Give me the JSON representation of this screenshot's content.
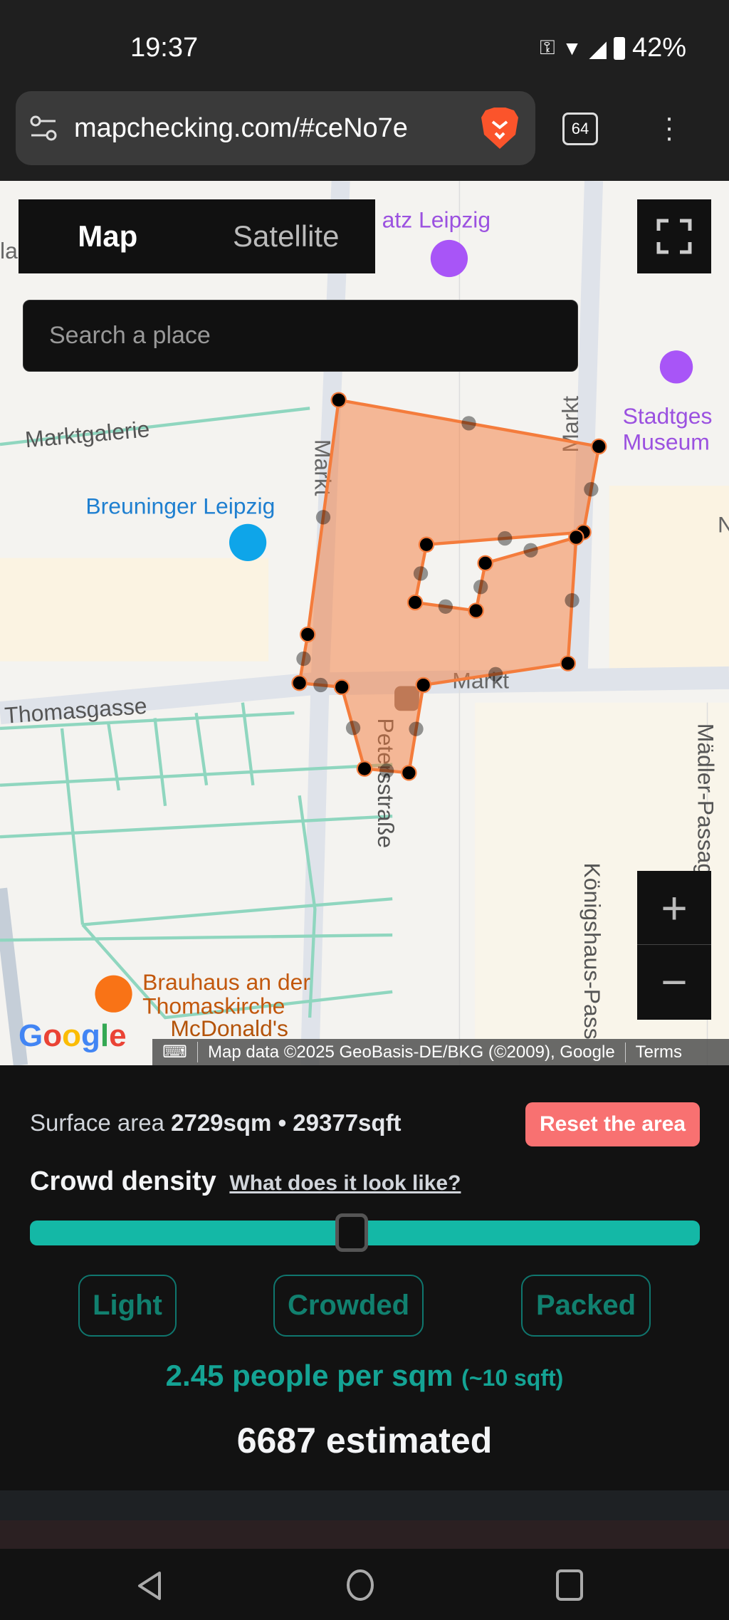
{
  "status_bar": {
    "time": "19:37",
    "battery": "42%",
    "icons": [
      "vpn-key-icon",
      "wifi-icon",
      "signal-icon",
      "battery-icon"
    ]
  },
  "browser": {
    "url": "mapchecking.com/#ceNo7e",
    "tab_count": "64",
    "icons": [
      "site-settings-icon",
      "brave-lion-icon",
      "menu-dots-icon"
    ]
  },
  "map": {
    "toggle": {
      "map": "Map",
      "satellite": "Satellite",
      "selected": "Map"
    },
    "search_placeholder": "Search a place",
    "zoom_in": "+",
    "zoom_out": "−",
    "labels": {
      "platz": "atz Leipzig",
      "marktgalerie": "Marktgalerie",
      "breuninger": "Breuninger Leipzig",
      "museum1": "Stadtges",
      "museum2": "Museum",
      "markt1": "Markt",
      "markt2": "Markt",
      "markt3": "Markt",
      "thomasgasse": "Thomasgasse",
      "petersstrasse": "Petersstraße",
      "maedler": "Mädler-Passage",
      "koenigshaus": "Königshaus-Pass",
      "brauhaus1": "Brauhaus an der",
      "brauhaus2": "Thomaskirche",
      "mcdonalds": "McDonald's",
      "n": "N",
      "la": "la"
    },
    "google_logo": "Google",
    "attribution": "Map data ©2025 GeoBasis-DE/BKG (©2009), Google",
    "terms": "Terms",
    "polygon_color": "#f47c3c"
  },
  "panel": {
    "surface_label": "Surface area",
    "surface_sqm": "2729sqm",
    "separator": "•",
    "surface_sqft": "29377sqft",
    "reset": "Reset the area",
    "density_title": "Crowd density",
    "density_link": "What does it look like?",
    "slider_fraction": 0.48,
    "presets": [
      "Light",
      "Crowded",
      "Packed"
    ],
    "rate": "2.45 people per sqm",
    "rate_sqft": "(~10 sqft)",
    "estimate": "6687 estimated",
    "accent": "#14b8a6",
    "reset_color": "#f87171"
  },
  "nav": {
    "icons": [
      "back-icon",
      "home-icon",
      "recents-icon"
    ]
  }
}
